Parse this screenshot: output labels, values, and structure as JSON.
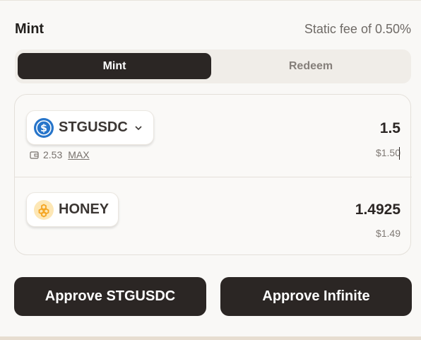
{
  "header": {
    "title": "Mint",
    "fee_text": "Static fee of 0.50%"
  },
  "tabs": [
    {
      "label": "Mint",
      "active": true
    },
    {
      "label": "Redeem",
      "active": false
    }
  ],
  "input_token": {
    "symbol": "STGUSDC",
    "icon": "usdc-icon",
    "balance": "2.53",
    "max_label": "MAX",
    "amount": "1.5",
    "usd_value": "$1.50"
  },
  "output_token": {
    "symbol": "HONEY",
    "icon": "honey-icon",
    "amount": "1.4925",
    "usd_value": "$1.49"
  },
  "actions": {
    "approve_label": "Approve STGUSDC",
    "approve_infinite_label": "Approve Infinite"
  },
  "colors": {
    "dark": "#2b2624",
    "usdc_blue": "#2775ca",
    "honey_orange": "#f5a623"
  }
}
